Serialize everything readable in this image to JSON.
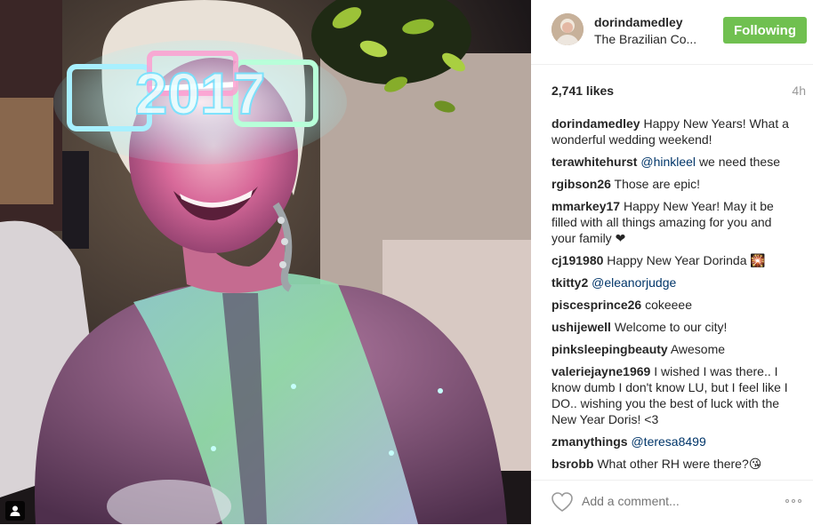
{
  "post": {
    "photo_alt": "woman wearing glowing 2017 glasses",
    "glasses_text": "2017"
  },
  "header": {
    "username": "dorindamedley",
    "location": "The Brazilian Co...",
    "follow_label": "Following",
    "follow_color": "#70c050"
  },
  "stats": {
    "likes": "2,741 likes",
    "age": "4h"
  },
  "comments": [
    {
      "user": "dorindamedley",
      "mention": "",
      "text": "Happy New Years! What a wonderful wedding weekend!"
    },
    {
      "user": "terawhitehurst",
      "mention": "@hinkleel",
      "text": "we need these"
    },
    {
      "user": "rgibson26",
      "mention": "",
      "text": "Those are epic!"
    },
    {
      "user": "mmarkey17",
      "mention": "",
      "text": "Happy New Year! May it be filled with all things amazing for you and your family ❤"
    },
    {
      "user": "cj191980",
      "mention": "",
      "text": "Happy New Year Dorinda 🎇"
    },
    {
      "user": "tkitty2",
      "mention": "@eleanorjudge",
      "text": ""
    },
    {
      "user": "piscesprince26",
      "mention": "",
      "text": "cokeeee"
    },
    {
      "user": "ushijewell",
      "mention": "",
      "text": "Welcome to our city!"
    },
    {
      "user": "pinksleepingbeauty",
      "mention": "",
      "text": "Awesome"
    },
    {
      "user": "valeriejayne1969",
      "mention": "",
      "text": "I wished I was there.. I know dumb I don't know LU, but I feel like I DO.. wishing you the best of luck with the New Year Doris! <3"
    },
    {
      "user": "zmanythings",
      "mention": "@teresa8499",
      "text": ""
    },
    {
      "user": "bsrobb",
      "mention": "",
      "text": "What other RH were there?😘"
    }
  ],
  "footer": {
    "comment_placeholder": "Add a comment...",
    "like_icon": "heart-outline-icon",
    "more_icon": "more-options-icon"
  }
}
